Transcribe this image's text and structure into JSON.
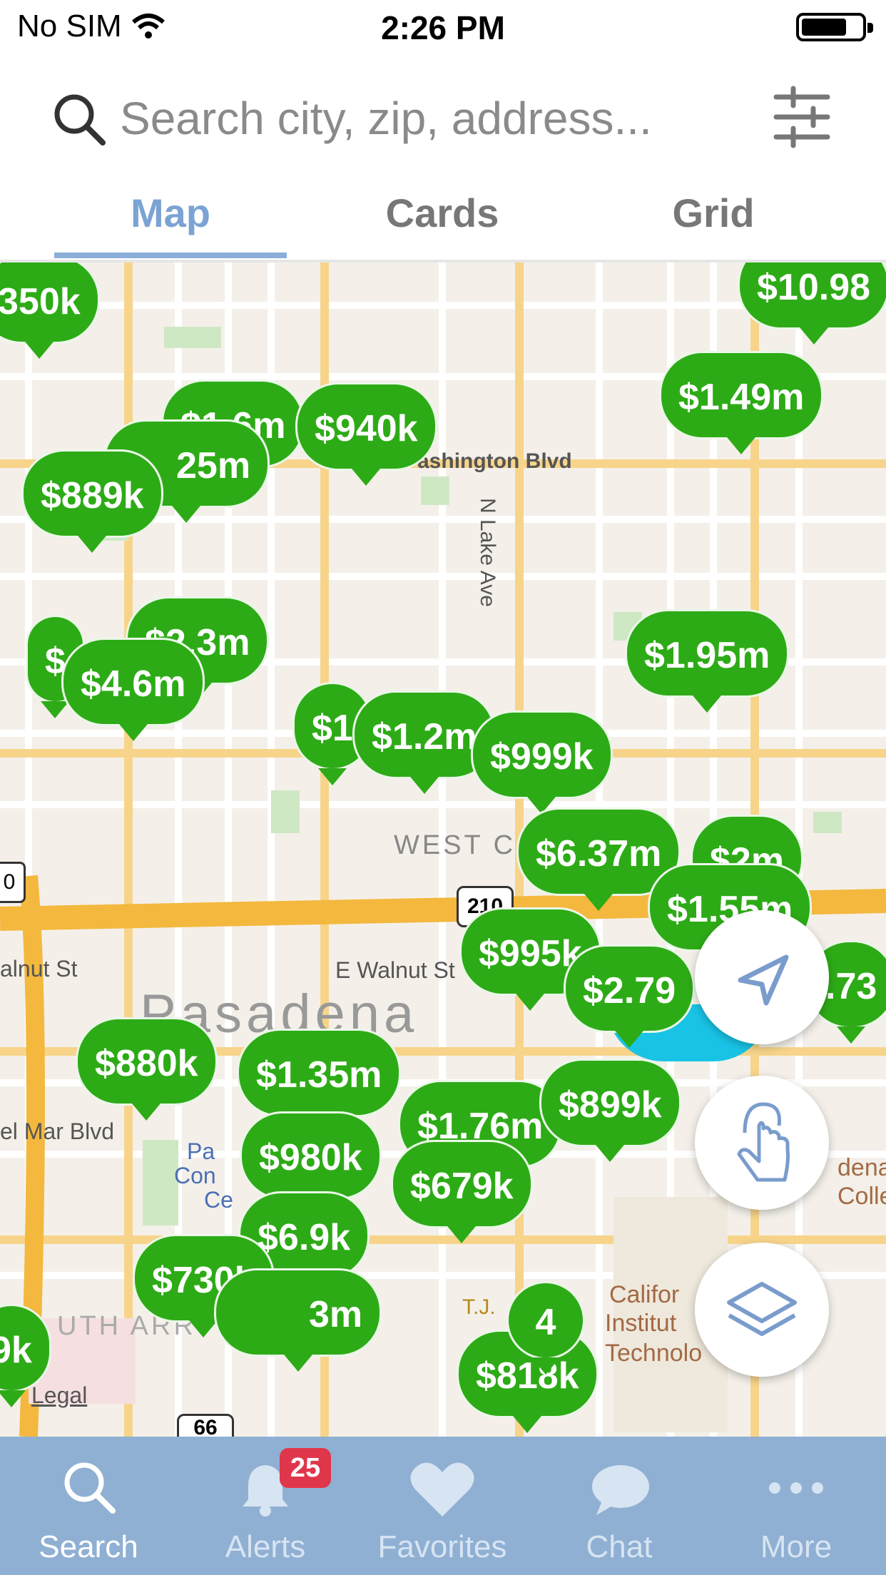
{
  "status_bar": {
    "carrier": "No SIM",
    "time": "2:26 PM"
  },
  "search": {
    "placeholder": "Search city, zip, address..."
  },
  "view_tabs": [
    {
      "label": "Map",
      "active": true
    },
    {
      "label": "Cards"
    },
    {
      "label": "Grid"
    }
  ],
  "map": {
    "street_labels": [
      "ashington Blvd",
      "N Lake Ave",
      "E Walnut St",
      "alnut St",
      "el Mar Blvd",
      "WEST C",
      "Pasadena",
      "UTH ARR",
      "Legal",
      "T.J.",
      "210",
      "66",
      "0"
    ],
    "poi_labels": [
      "Califor",
      "Institut",
      "Technolo",
      "dena",
      "Colleg",
      "Pa",
      "Con",
      "Ce"
    ],
    "price_pins": [
      "350k",
      "$10.98",
      "$1.49m",
      "$1.6m",
      "$940k",
      "25m",
      "$889k",
      "$2.3m",
      "$",
      "$4.6m",
      "$1.95m",
      "$1",
      "$1.2m",
      "$999k",
      "$6.37m",
      "$2m",
      "$1.55m",
      "$995k",
      "$2.79",
      ".73",
      "$880k",
      "$1.35m",
      "$1.76m",
      "$899k",
      "$980k",
      "$679k",
      "$6.9k",
      "$730k",
      "3m",
      "9k",
      "$818k"
    ],
    "cluster_pin": "4",
    "colors": {
      "pin": "#2dab16",
      "selected": "#19c3e6"
    }
  },
  "map_controls": [
    "location-arrow-icon",
    "hand-tap-icon",
    "layers-icon"
  ],
  "tab_bar": {
    "items": [
      {
        "label": "Search",
        "icon": "search-icon",
        "active": true
      },
      {
        "label": "Alerts",
        "icon": "bell-icon",
        "badge": "25"
      },
      {
        "label": "Favorites",
        "icon": "heart-icon"
      },
      {
        "label": "Chat",
        "icon": "chat-icon"
      },
      {
        "label": "More",
        "icon": "more-icon"
      }
    ]
  }
}
